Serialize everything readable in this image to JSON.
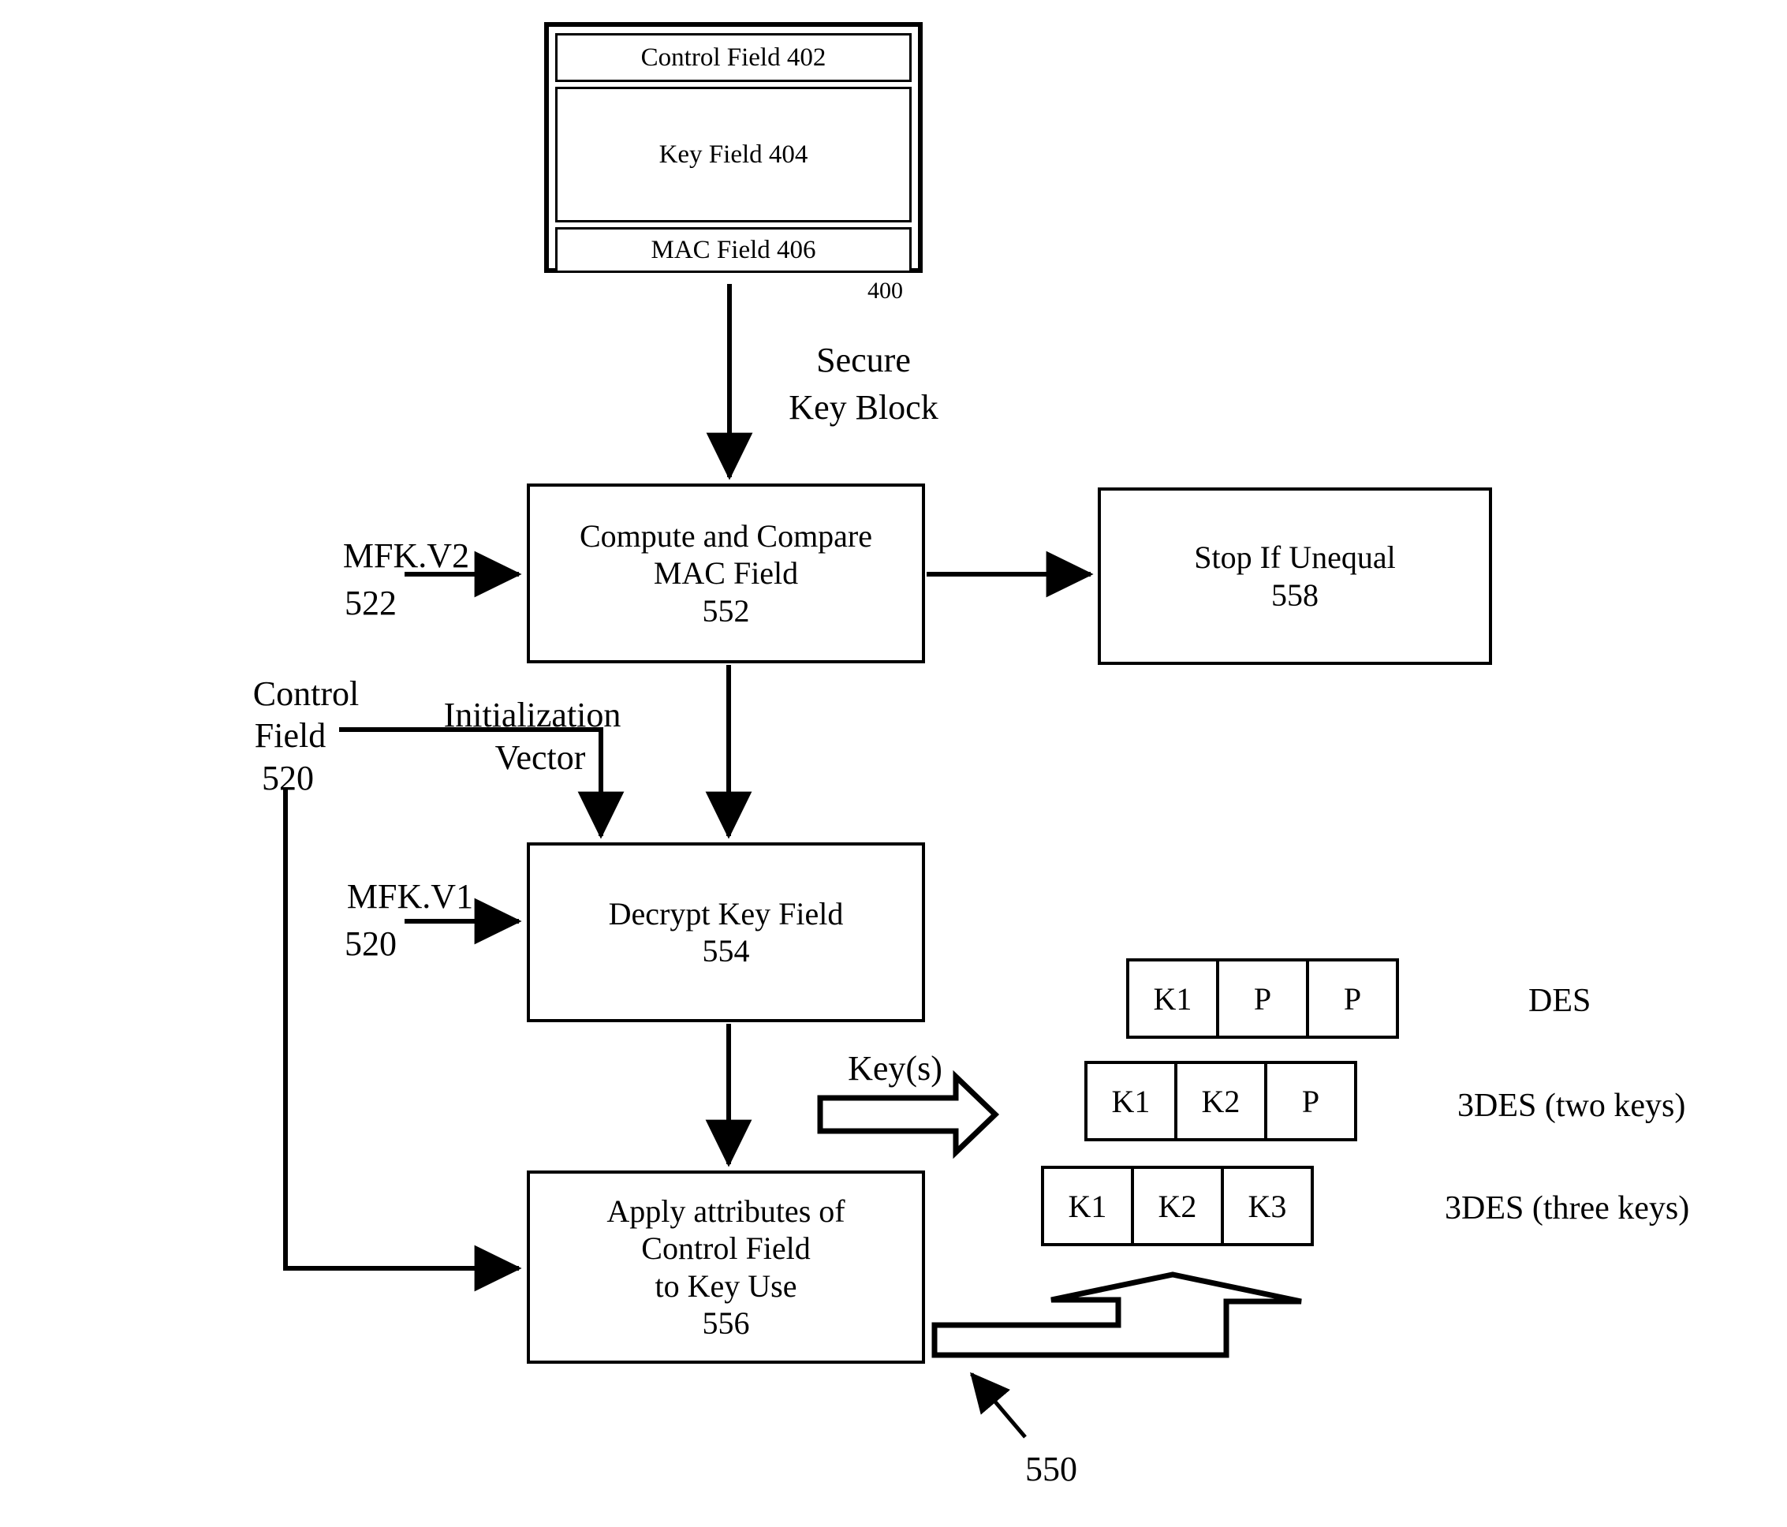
{
  "figure": {
    "key_block": {
      "label_ref": "400",
      "fields": [
        {
          "text": "Control Field 402"
        },
        {
          "text": "Key Field 404"
        },
        {
          "text": "MAC Field 406"
        }
      ]
    },
    "flow_labels": {
      "secure_key_block_line1": "Secure",
      "secure_key_block_line2": "Key Block",
      "keys_arrow": "Key(s)",
      "initialization_vector_line1": "Initialization",
      "initialization_vector_line2": "Vector",
      "control_field_line1": "Control",
      "control_field_line2": "Field",
      "control_field_ref": "520",
      "mfk_v2_name": "MFK.V2",
      "mfk_v2_ref": "522",
      "mfk_v1_name": "MFK.V1",
      "mfk_v1_ref": "520",
      "keyset_ref": "550"
    },
    "process_boxes": [
      {
        "id": "compute-compare-mac",
        "line1": "Compute and Compare",
        "line2": "MAC Field",
        "ref": "552"
      },
      {
        "id": "stop-if-unequal",
        "line1": "Stop If Unequal",
        "line2": "",
        "ref": "558"
      },
      {
        "id": "decrypt-key-field",
        "line1": "Decrypt Key Field",
        "line2": "",
        "ref": "554"
      },
      {
        "id": "apply-attributes",
        "line1": "Apply attributes of",
        "line2": "Control Field",
        "line3": "to Key Use",
        "ref": "556"
      }
    ],
    "key_layouts": [
      {
        "cells": [
          "K1",
          "P",
          "P"
        ],
        "type": "DES"
      },
      {
        "cells": [
          "K1",
          "K2",
          "P"
        ],
        "type": "3DES (two keys)"
      },
      {
        "cells": [
          "K1",
          "K2",
          "K3"
        ],
        "type": "3DES (three keys)"
      }
    ]
  },
  "colors": {
    "ink": "#000000",
    "paper": "#ffffff"
  }
}
